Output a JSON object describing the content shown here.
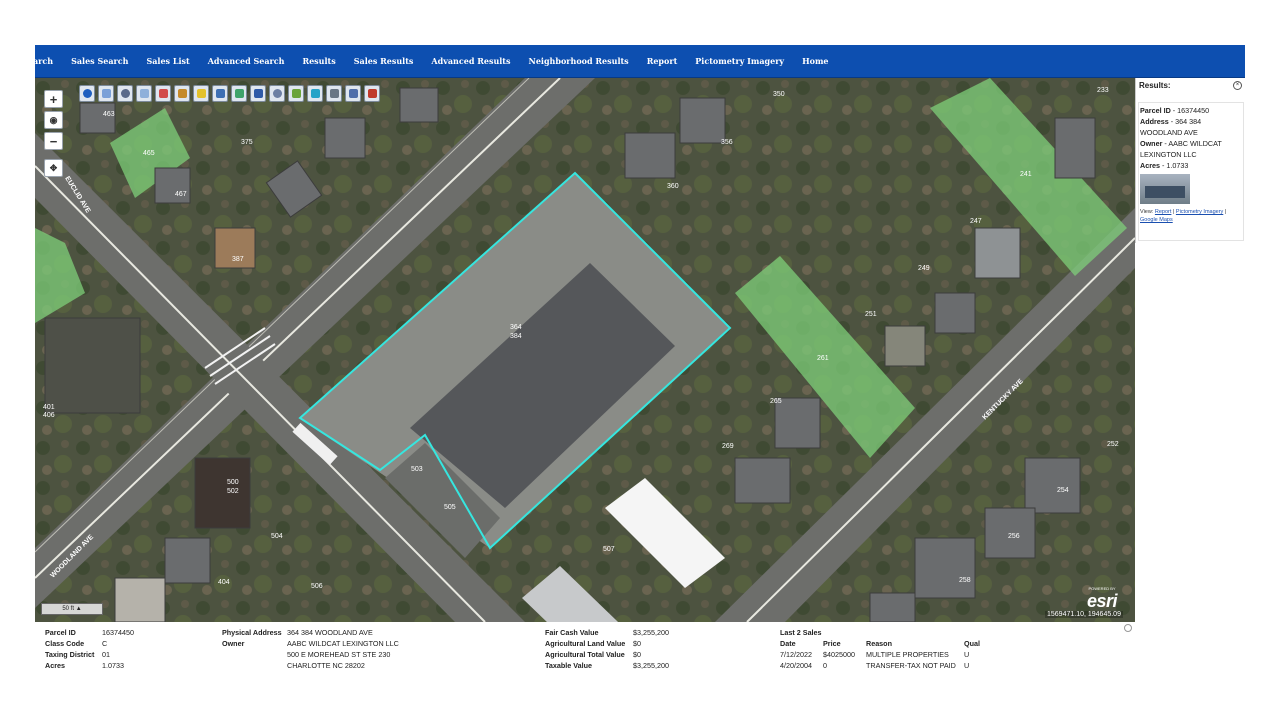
{
  "nav": {
    "items": [
      "arch",
      "Sales Search",
      "Sales List",
      "Advanced Search",
      "Results",
      "Sales Results",
      "Advanced Results",
      "Neighborhood Results",
      "Report",
      "Pictometry Imagery",
      "Home"
    ]
  },
  "map": {
    "zoom_in": "+",
    "zoom_out": "−",
    "scale_label": "50 ft",
    "esri_powered": "POWERED BY",
    "esri_logo": "esri",
    "coordinates": "1569471.10, 194645.09",
    "street_labels": {
      "euclid": "EUCLID AVE",
      "woodland": "WOODLAND AVE",
      "kentucky": "KENTUCKY AVE"
    },
    "lot_numbers": {
      "l463": "463",
      "l465": "465",
      "l467": "467",
      "l375": "375",
      "l387": "387",
      "l350": "350",
      "l356": "356",
      "l360": "360",
      "l241": "241",
      "l233": "233",
      "l247": "247",
      "l249": "249",
      "l251": "251",
      "l261": "261",
      "l265": "265",
      "l269": "269",
      "l252": "252",
      "l254": "254",
      "l256": "256",
      "l258": "258",
      "l503": "503",
      "l505": "505",
      "l507": "507",
      "l500": "500",
      "l502": "502",
      "l504": "504",
      "l506": "506",
      "l404": "404",
      "l401": "401",
      "l406": "406",
      "center_a": "364",
      "center_b": "384"
    }
  },
  "results": {
    "title": "Results:",
    "parcel_label": "Parcel ID",
    "parcel_value": "- 16374450",
    "address_label": "Address",
    "address_value": "- 364 384 WOODLAND AVE",
    "owner_label": "Owner",
    "owner_value": "- AABC WILDCAT LEXINGTON LLC",
    "acres_label": "Acres",
    "acres_value": "- 1.0733",
    "view_label": "View:",
    "link_report": "Report",
    "link_pictometry": "Pictometry Imagery",
    "link_google": "Google Maps"
  },
  "details": {
    "parcel_id_label": "Parcel ID",
    "parcel_id": "16374450",
    "class_code_label": "Class Code",
    "class_code": "C",
    "taxing_district_label": "Taxing District",
    "taxing_district": "01",
    "acres_label": "Acres",
    "acres": "1.0733",
    "physical_address_label": "Physical Address",
    "physical_address": "364 384 WOODLAND AVE",
    "owner_label": "Owner",
    "owner_1": "AABC WILDCAT LEXINGTON LLC",
    "owner_2": "500 E MOREHEAD ST STE 230",
    "owner_3": "CHARLOTTE NC 28202",
    "fair_cash_label": "Fair Cash Value",
    "fair_cash": "$3,255,200",
    "ag_land_label": "Agricultural Land Value",
    "ag_land": "$0",
    "ag_total_label": "Agricultural Total Value",
    "ag_total": "$0",
    "taxable_label": "Taxable Value",
    "taxable": "$3,255,200",
    "sales_title": "Last 2 Sales",
    "sales_headers": [
      "Date",
      "Price",
      "Reason",
      "Qual"
    ],
    "sales_rows": [
      [
        "7/12/2022",
        "$4025000",
        "MULTIPLE PROPERTIES",
        "U"
      ],
      [
        "4/20/2004",
        "0",
        "TRANSFER-TAX NOT PAID",
        "U"
      ]
    ]
  }
}
